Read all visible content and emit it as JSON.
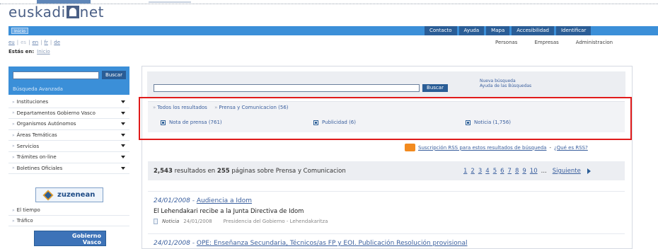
{
  "header": {
    "logo_text_left": "euskadi",
    "logo_text_right": "net",
    "inicio": "Inicio",
    "nav_tabs": [
      "Contacto",
      "Ayuda",
      "Mapa",
      "Accesibilidad",
      "Identificar"
    ],
    "languages": [
      "eu",
      "es",
      "en",
      "fr",
      "de"
    ],
    "audience_links": [
      "Personas",
      "Empresas",
      "Administracion"
    ],
    "breadcrumb_label": "Estás en:",
    "breadcrumb_link": "Inicio"
  },
  "sidebar": {
    "search_button": "Buscar",
    "advanced_search": "Búsqueda Avanzada",
    "menu": [
      "Instituciones",
      "Departamentos Gobierno Vasco",
      "Organismos Autónomos",
      "Áreas Temáticas",
      "Servicios",
      "Trámites on-line",
      "Boletines Oficiales"
    ],
    "zuzenean": "zuzenean",
    "extra": [
      "El tiempo",
      "Tráfico"
    ],
    "gobierno_line1": "Gobierno",
    "gobierno_line2": "Vasco"
  },
  "search": {
    "button": "Buscar",
    "new_search": "Nueva búsqueda",
    "help": "Ayuda de las Búsquedas"
  },
  "filters": {
    "tab_all": "Todos los resultados",
    "tab_current": "Prensa y Comunicacion (56)",
    "options": [
      "Nota de prensa (761)",
      "Publicidad (6)",
      "Noticia (1,756)"
    ]
  },
  "rss": {
    "subscribe": "Suscripción RSS para estos resultados de búsqueda",
    "dash": "-",
    "what": "¿Qué es RSS?"
  },
  "results_summary": {
    "count": "2,543",
    "text1": "resultados en",
    "pages": "255",
    "text2": "páginas sobre Prensa y Comunicacion",
    "page_links": [
      "1",
      "2",
      "3",
      "4",
      "5",
      "6",
      "7",
      "8",
      "9",
      "10",
      "..."
    ],
    "next": "Siguiente"
  },
  "results": [
    {
      "date": "24/01/2008",
      "title": "Audiencia a Idom",
      "description": "El Lehendakari recibe a la Junta Directiva de Idom",
      "type": "Noticia",
      "meta_date": "24/01/2008",
      "source": "Presidencia del Gobierno - Lehendakaritza"
    },
    {
      "date": "24/01/2008",
      "title": "OPE: Enseñanza Secundaria, Técnicos/as FP y EOI. Publicación Resolución provisional"
    }
  ]
}
